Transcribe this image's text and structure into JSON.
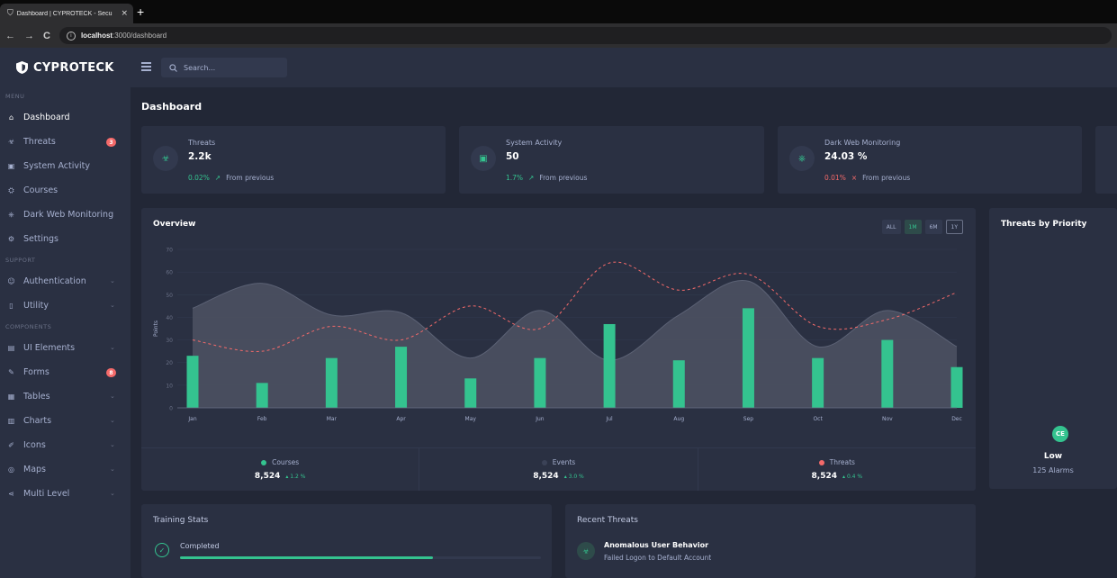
{
  "browser": {
    "tab_title": "Dashboard | CYPROTECK - Secu",
    "tab_close": "×",
    "new_tab": "+",
    "url_host": "localhost",
    "url_rest": ":3000/dashboard",
    "back": "←",
    "forward": "→",
    "reload": "C",
    "info": "i"
  },
  "brand": {
    "name": "CYPROTECK"
  },
  "sidebar": {
    "sections": [
      {
        "title": "MENU",
        "items": [
          {
            "label": "Dashboard",
            "icon": "home-icon",
            "glyph": "⌂",
            "active": true
          },
          {
            "label": "Threats",
            "icon": "biohazard-icon",
            "glyph": "☣",
            "badge": "3"
          },
          {
            "label": "System Activity",
            "icon": "chip-icon",
            "glyph": "▣"
          },
          {
            "label": "Courses",
            "icon": "graduation-icon",
            "glyph": "⛭"
          },
          {
            "label": "Dark Web Monitoring",
            "icon": "network-icon",
            "glyph": "⎈"
          },
          {
            "label": "Settings",
            "icon": "gear-icon",
            "glyph": "⚙"
          }
        ]
      },
      {
        "title": "SUPPORT",
        "items": [
          {
            "label": "Authentication",
            "icon": "user-icon",
            "glyph": "☺",
            "chevron": true
          },
          {
            "label": "Utility",
            "icon": "file-icon",
            "glyph": "▯",
            "chevron": true
          }
        ]
      },
      {
        "title": "COMPONENTS",
        "items": [
          {
            "label": "UI Elements",
            "icon": "briefcase-icon",
            "glyph": "▤",
            "chevron": true
          },
          {
            "label": "Forms",
            "icon": "form-icon",
            "glyph": "✎",
            "badge": "8"
          },
          {
            "label": "Tables",
            "icon": "table-icon",
            "glyph": "▦",
            "chevron": true
          },
          {
            "label": "Charts",
            "icon": "bar-chart-icon",
            "glyph": "▥",
            "chevron": true
          },
          {
            "label": "Icons",
            "icon": "brush-icon",
            "glyph": "✐",
            "chevron": true
          },
          {
            "label": "Maps",
            "icon": "map-icon",
            "glyph": "◎",
            "chevron": true
          },
          {
            "label": "Multi Level",
            "icon": "share-icon",
            "glyph": "⋖",
            "chevron": true
          }
        ]
      }
    ],
    "chevron": "⌄"
  },
  "topbar": {
    "search_placeholder": "Search..."
  },
  "page": {
    "title": "Dashboard"
  },
  "stats": [
    {
      "label": "Threats",
      "value": "2.2k",
      "change": "0.02%",
      "direction": "up",
      "arrow": "↗",
      "note": "From previous",
      "glyph": "☣"
    },
    {
      "label": "System Activity",
      "value": "50",
      "change": "1.7%",
      "direction": "up",
      "arrow": "↗",
      "note": "From previous",
      "glyph": "▣"
    },
    {
      "label": "Dark Web Monitoring",
      "value": "24.03 %",
      "change": "0.01%",
      "direction": "down",
      "arrow": "×",
      "note": "From previous",
      "glyph": "⎈"
    }
  ],
  "overview": {
    "title": "Overview",
    "ranges": [
      {
        "label": "ALL",
        "state": "default"
      },
      {
        "label": "1M",
        "state": "active"
      },
      {
        "label": "6M",
        "state": "default"
      },
      {
        "label": "1Y",
        "state": "outlined"
      }
    ],
    "legend": [
      {
        "name": "Courses",
        "color": "#34c38f",
        "value": "8,524",
        "pct": "1.2 %"
      },
      {
        "name": "Events",
        "color": "#32394e",
        "value": "8,524",
        "pct": "3.0 %"
      },
      {
        "name": "Threats",
        "color": "#f46a6a",
        "value": "8,524",
        "pct": "0.4 %"
      }
    ]
  },
  "chart_data": {
    "type": "bar",
    "title": "Overview",
    "xlabel": "",
    "ylabel": "Points",
    "ylim": [
      0,
      70
    ],
    "yticks": [
      0,
      10,
      20,
      30,
      40,
      50,
      60,
      70
    ],
    "grid": true,
    "categories": [
      "Jan",
      "Feb",
      "Mar",
      "Apr",
      "May",
      "Jun",
      "Jul",
      "Aug",
      "Sep",
      "Oct",
      "Nov",
      "Dec"
    ],
    "series": [
      {
        "name": "Courses",
        "kind": "bar",
        "color": "#34c38f",
        "values": [
          23,
          11,
          22,
          27,
          13,
          22,
          37,
          21,
          44,
          22,
          30,
          18
        ]
      },
      {
        "name": "Events",
        "kind": "area",
        "color": "#6a7187",
        "values": [
          44,
          55,
          41,
          42,
          22,
          43,
          21,
          41,
          56,
          27,
          43,
          27
        ]
      },
      {
        "name": "Threats",
        "kind": "line-dashed",
        "color": "#f46a6a",
        "values": [
          30,
          25,
          36,
          30,
          45,
          35,
          64,
          52,
          59,
          36,
          39,
          51
        ]
      }
    ]
  },
  "priority": {
    "title": "Threats by Priority",
    "icon_text": "CE",
    "level": "Low",
    "count": "125 Alarms"
  },
  "training": {
    "title": "Training Stats",
    "label": "Completed",
    "progress": 0.7
  },
  "recent": {
    "title": "Recent Threats",
    "item_title": "Anomalous User Behavior",
    "item_sub": "Failed Logon to Default Account",
    "glyph": "☣"
  }
}
